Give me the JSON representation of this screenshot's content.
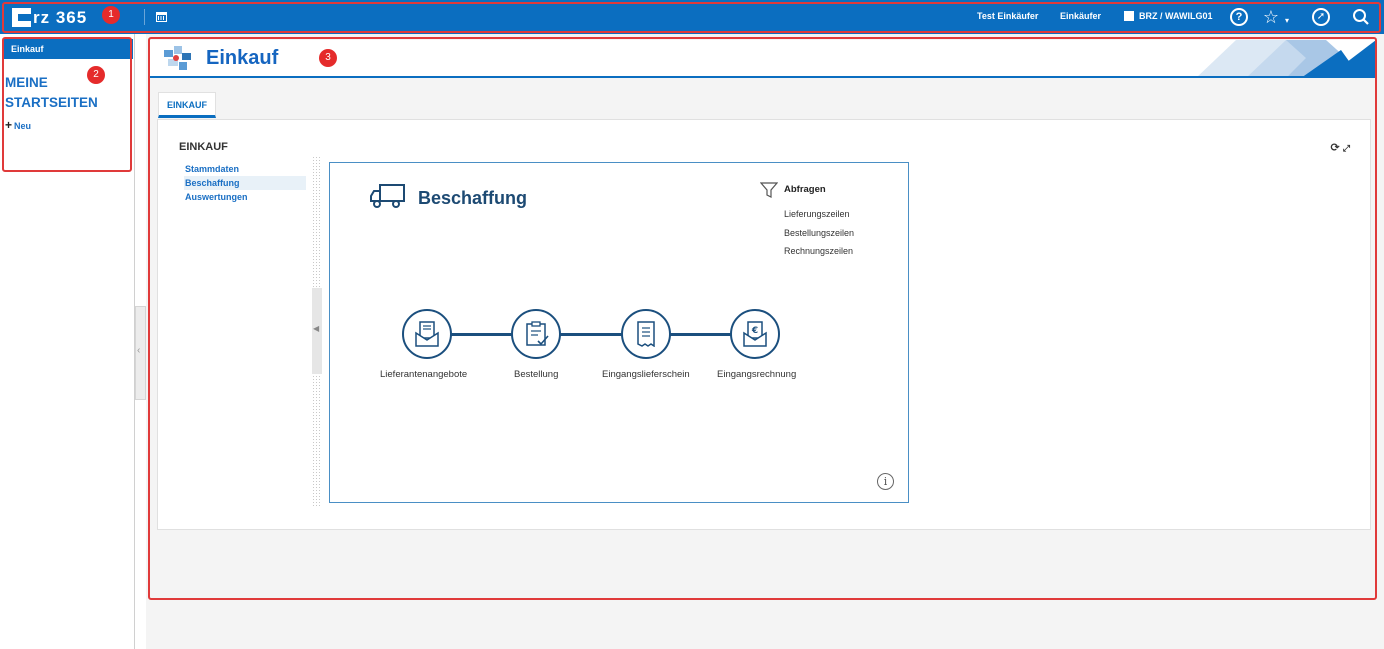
{
  "topbar": {
    "logo": "rz 365",
    "user_name": "Test Einkäufer",
    "role": "Einkäufer",
    "company": "BRZ / WAWILG01",
    "help_icon": "?",
    "search_icon": "⌕"
  },
  "annotations": {
    "badge_1": "1",
    "badge_2": "2",
    "badge_3": "3"
  },
  "sidebar": {
    "header": "Einkauf",
    "title": "MEINE STARTSEITEN",
    "new_label": "Neu"
  },
  "page": {
    "title": "Einkauf",
    "tab": "EINKAUF"
  },
  "panel": {
    "title": "EINKAUF",
    "nav": [
      "Stammdaten",
      "Beschaffung",
      "Auswertungen"
    ],
    "active_nav": "Beschaffung"
  },
  "card": {
    "title": "Beschaffung",
    "queries_title": "Abfragen",
    "queries": [
      "Lieferungszeilen",
      "Bestellungszeilen",
      "Rechnungszeilen"
    ],
    "steps": [
      "Lieferantenangebote",
      "Bestellung",
      "Eingangslieferschein",
      "Eingangsrechnung"
    ]
  },
  "colors": {
    "brand": "#0b6ec0",
    "annotation": "#e03a3a",
    "process": "#1b4f7e"
  }
}
